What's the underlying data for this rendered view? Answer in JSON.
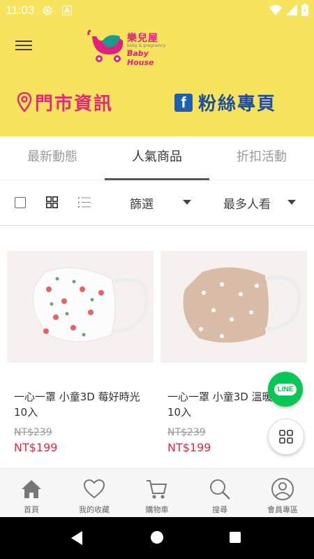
{
  "status": {
    "time": "11:03"
  },
  "header": {
    "logo_title": "樂兒屋",
    "logo_sub": "baby & pregnancy co.",
    "logo_en": "Baby House",
    "store_info_label": "門市資訊",
    "fan_page_label": "粉絲專頁"
  },
  "tabs": [
    {
      "label": "最新動態",
      "active": false
    },
    {
      "label": "人氣商品",
      "active": true
    },
    {
      "label": "折扣活動",
      "active": false
    }
  ],
  "toolbar": {
    "filter_label": "篩選",
    "sort_label": "最多人看"
  },
  "products": [
    {
      "title": "一心一罩 小童3D 莓好時光 10入",
      "price_original": "NT$239",
      "price": "NT$199"
    },
    {
      "title": "一心一罩 小童3D 溫暖冬日 10入",
      "price_original": "NT$239",
      "price": "NT$199"
    }
  ],
  "fab": {
    "line_label": "LINE"
  },
  "bottom_nav": [
    {
      "label": "首頁",
      "icon": "home-icon"
    },
    {
      "label": "我的收藏",
      "icon": "heart-icon"
    },
    {
      "label": "購物車",
      "icon": "cart-icon"
    },
    {
      "label": "搜尋",
      "icon": "search-icon"
    },
    {
      "label": "會員專區",
      "icon": "user-icon"
    }
  ],
  "colors": {
    "header_bg": "#f8e45c",
    "brand_pink": "#e02b7a",
    "fb_blue": "#1f5fae",
    "price_red": "#e8293e",
    "line_green": "#06c755"
  }
}
